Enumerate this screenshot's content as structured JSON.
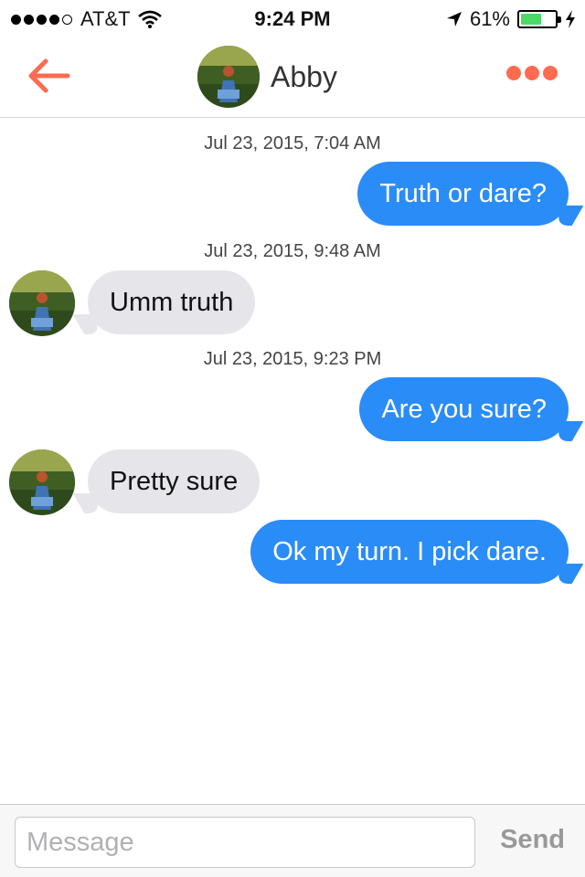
{
  "status_bar": {
    "carrier": "AT&T",
    "time": "9:24 PM",
    "battery_percent": "61%",
    "battery_level": 0.61,
    "signal_bars": 4,
    "signal_max": 5,
    "icons": [
      "signal-dots-icon",
      "wifi-icon",
      "location-arrow-icon",
      "battery-icon",
      "charging-bolt-icon"
    ]
  },
  "nav": {
    "contact_name": "Abby",
    "back_icon": "arrow-left-icon",
    "more_icon": "more-dots-icon",
    "accent_color": "#ff6b51"
  },
  "conversation": [
    {
      "type": "timestamp",
      "text": "Jul 23, 2015, 7:04 AM"
    },
    {
      "type": "message",
      "direction": "out",
      "text": "Truth or dare?"
    },
    {
      "type": "timestamp",
      "text": "Jul 23, 2015, 9:48 AM"
    },
    {
      "type": "message",
      "direction": "in",
      "text": "Umm truth"
    },
    {
      "type": "timestamp",
      "text": "Jul 23, 2015, 9:23 PM"
    },
    {
      "type": "message",
      "direction": "out",
      "text": "Are you sure?"
    },
    {
      "type": "message",
      "direction": "in",
      "text": "Pretty sure"
    },
    {
      "type": "message",
      "direction": "out",
      "text": "Ok my turn. I pick dare."
    }
  ],
  "composer": {
    "placeholder": "Message",
    "value": "",
    "send_label": "Send"
  },
  "colors": {
    "outgoing_bubble": "#2a8cf7",
    "incoming_bubble": "#e6e5ea",
    "battery_green": "#4cd964"
  }
}
